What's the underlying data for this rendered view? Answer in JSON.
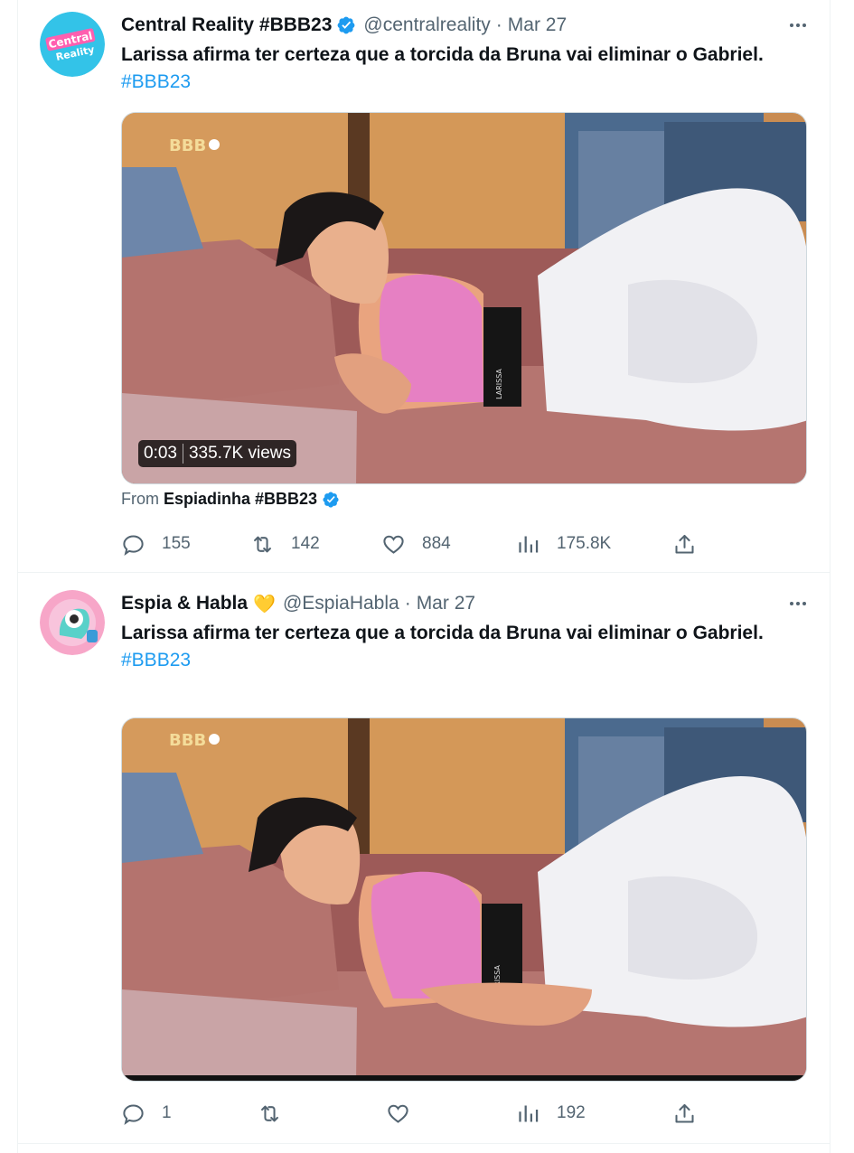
{
  "tweets": [
    {
      "name": "Central Reality #BBB23",
      "handle": "@centralreality",
      "separator": "·",
      "time": "Mar 27",
      "avatar_text": "Central Reality",
      "text": "Larissa afirma ter certeza que a torcida da Bruna vai eliminar o Gabriel.",
      "hashtag": "#BBB23",
      "video": {
        "duration": "0:03",
        "views": "335.7K views",
        "watermark": "BBB",
        "shirt_label": "LARISSA"
      },
      "from_label": "From",
      "from_source": "Espiadinha #BBB23",
      "replies": "155",
      "reposts": "142",
      "likes": "884",
      "views": "175.8K"
    },
    {
      "name": "Espia & Habla",
      "name_emoji": "💛",
      "handle": "@EspiaHabla",
      "separator": "·",
      "time": "Mar 27",
      "text": "Larissa afirma ter certeza que a torcida da Bruna vai eliminar o Gabriel.",
      "hashtag": "#BBB23",
      "video": {
        "watermark": "BBB",
        "shirt_label": "LARISSA"
      },
      "replies": "1",
      "reposts": "",
      "likes": "",
      "views": "192"
    }
  ],
  "colors": {
    "accent": "#1d9bf0",
    "text_primary": "#0f1419",
    "text_secondary": "#536471",
    "divider": "#eff3f4"
  },
  "icons": [
    "verified-badge-icon",
    "more-icon",
    "reply-icon",
    "repost-icon",
    "like-icon",
    "views-icon",
    "share-icon"
  ]
}
